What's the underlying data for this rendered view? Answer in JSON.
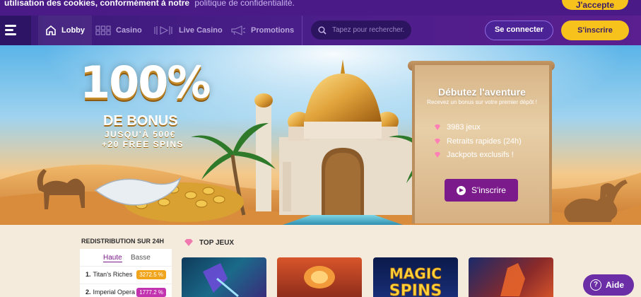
{
  "cookie": {
    "text": "utilisation des cookies, conformément à notre",
    "link": "politique de confidentialité.",
    "accept_label": "J'accepte"
  },
  "header": {
    "nav": [
      {
        "label": "Lobby",
        "icon": "home-icon",
        "active": true
      },
      {
        "label": "Casino",
        "icon": "grid-icon",
        "active": false
      },
      {
        "label": "Live Casino",
        "icon": "live-play-icon",
        "active": false
      },
      {
        "label": "Promotions",
        "icon": "megaphone-icon",
        "active": false
      }
    ],
    "search_placeholder": "Tapez pour rechercher.",
    "login_label": "Se connecter",
    "signup_label": "S'inscrire"
  },
  "hero": {
    "bonus_percent": "100%",
    "bonus_line1": "DE BONUS",
    "bonus_line2": "JUSQU'À 500€",
    "bonus_line3": "+20 FREE SPINS",
    "card_title": "Débutez l'aventure",
    "card_subtitle": "Recevez un bonus sur votre premier dépôt !",
    "features": [
      "3983 jeux",
      "Retraits rapides (24h)",
      "Jackpots exclusifs !"
    ],
    "cta_label": "S'inscrire"
  },
  "redistribution": {
    "title": "REDISTRIBUTION SUR 24H",
    "tabs": [
      "Haute",
      "Basse"
    ],
    "active_tab": "Haute",
    "rows": [
      {
        "rank": "1.",
        "name": "Titan's Riches",
        "value": "3272.5 %",
        "color": "#f0a51c"
      },
      {
        "rank": "2.",
        "name": "Imperial Opera",
        "value": "1777.2 %",
        "color": "#c233b0"
      }
    ]
  },
  "top_games": {
    "title": "TOP JEUX"
  },
  "help_label": "Aide",
  "colors": {
    "brand_purple": "#4b1e8a",
    "accent_yellow": "#f7c21b",
    "cta_purple": "#7b1a8a"
  }
}
